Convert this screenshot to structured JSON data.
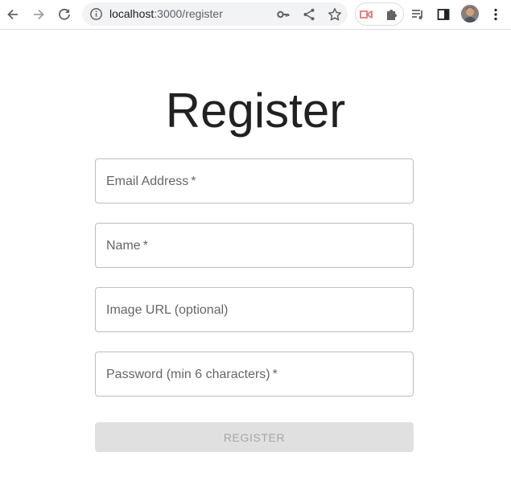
{
  "browser": {
    "url_host": "localhost",
    "url_path": ":3000/register",
    "icons": {
      "back": "arrow-left-icon",
      "forward": "arrow-right-icon",
      "reload": "reload-icon",
      "site_info": "info-icon",
      "password_key": "key-icon",
      "share": "share-icon",
      "bookmark": "star-icon",
      "extension_1": "video-extension-icon",
      "extensions": "puzzle-icon",
      "media": "playlist-icon",
      "side_panel": "side-panel-icon",
      "profile": "avatar",
      "menu": "kebab-menu-icon"
    }
  },
  "register_form": {
    "title": "Register",
    "fields": [
      {
        "label": "Email Address",
        "required": "*"
      },
      {
        "label": "Name",
        "required": "*"
      },
      {
        "label": "Image URL (optional)",
        "required": ""
      },
      {
        "label": "Password (min 6 characters)",
        "required": "*"
      }
    ],
    "submit_label": "REGISTER"
  },
  "colors": {
    "title_text": "#212121",
    "label_text": "#666666",
    "field_border": "#bdbdbd",
    "button_disabled_bg": "#e0e0e0",
    "button_disabled_text": "#a6a6a6"
  }
}
